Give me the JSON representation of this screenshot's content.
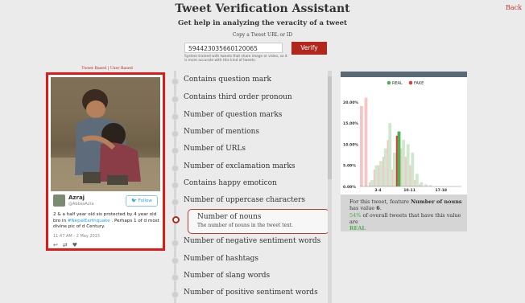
{
  "header": {
    "title": "Tweet Verification Assistant",
    "back_label": "Back",
    "subtitle": "Get help in analyzing the veracity of a tweet",
    "copy_label": "Copy a Tweet URL or ID"
  },
  "form": {
    "tweet_id_value": "594423035660120065",
    "verify_label": "Verify",
    "note": "System trained with tweets that share image or video, so it is more accurate with this kind of tweets."
  },
  "tweet": {
    "section_label": "Tweet Based | User Based",
    "user_name": "Azraj",
    "user_handle": "@AbbasAzra",
    "follow_label": "Follow",
    "text_before": "2 & a half year old sis protected by 4 year old bro in ",
    "hashtag": "#NepalEarthquake",
    "text_after": " . Perhaps 1 of d most divine pic of d Century.",
    "date": "11:47 AM - 2 May 2015"
  },
  "features": {
    "items": [
      "Contains question mark",
      "Contains third order pronoun",
      "Number of question marks",
      "Number of mentions",
      "Number of URLs",
      "Number of exclamation marks",
      "Contains happy emoticon",
      "Number of uppercase characters",
      "Number of nouns",
      "Number of negative sentiment words",
      "Number of hashtags",
      "Number of slang words",
      "Number of positive sentiment words"
    ],
    "selected_index": 8,
    "selected_title": "Number of nouns",
    "selected_description": "The number of nouns in the tweet text."
  },
  "chart": {
    "legend_real": "REAL",
    "legend_fake": "FAKE",
    "y_ticks": [
      "20.00%",
      "15.00%",
      "10.00%",
      "5.00%",
      "0.00%"
    ],
    "x_ticks": [
      "3-4",
      "10-11",
      "17-18"
    ],
    "real_color": "#4caf50",
    "fake_color": "#e53935"
  },
  "info": {
    "line1_pre": "For this tweet, feature ",
    "feature_name": "Number of nouns",
    "line1_post": " has value ",
    "value": "6",
    "percent": "54%",
    "line2_post": " of overall tweets that have this value are",
    "verdict": "REAL"
  },
  "chart_data": {
    "type": "bar",
    "title": "",
    "xlabel": "",
    "ylabel": "",
    "ylim": [
      0,
      23
    ],
    "x_tick_labels": [
      "3-4",
      "10-11",
      "17-18"
    ],
    "series": [
      {
        "name": "REAL",
        "values": [
          0,
          0,
          1.5,
          5,
          6,
          9,
          15,
          8,
          13,
          11,
          10,
          8,
          3,
          1,
          0.5,
          0.3,
          0,
          0,
          0,
          0
        ]
      },
      {
        "name": "FAKE",
        "values": [
          19,
          21,
          1,
          4,
          5,
          7,
          11,
          4,
          12,
          9,
          7,
          5,
          1.5,
          0.5,
          0,
          0,
          0,
          0,
          0,
          0
        ]
      }
    ]
  }
}
